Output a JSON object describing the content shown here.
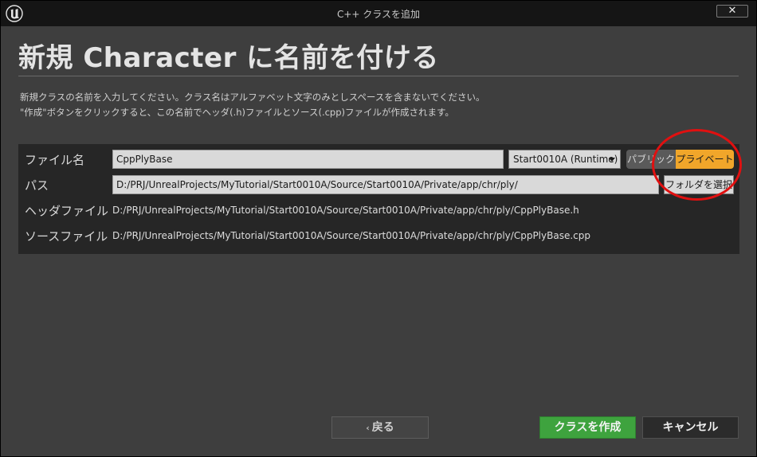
{
  "window": {
    "title": "C++ クラスを追加",
    "close_glyph": "✕"
  },
  "header": {
    "title": "新規 Character に名前を付ける",
    "description_line1": "新規クラスの名前を入力してください。クラス名はアルファベット文字のみとしスペースを含まないでください。",
    "description_line2": "\"作成\"ボタンをクリックすると、この名前でヘッダ(.h)ファイルとソース(.cpp)ファイルが作成されます。"
  },
  "form": {
    "name_label": "ファイル名",
    "name_value": "CppPlyBase",
    "module_value": "Start0010A (Runtime)",
    "visibility_public": "パブリック",
    "visibility_private": "プライベート",
    "selected_visibility": "private",
    "path_label": "パス",
    "path_value": "D:/PRJ/UnrealProjects/MyTutorial/Start0010A/Source/Start0010A/Private/app/chr/ply/",
    "browse_label": "フォルダを選択",
    "header_label": "ヘッダファイル",
    "header_value": "D:/PRJ/UnrealProjects/MyTutorial/Start0010A/Source/Start0010A/Private/app/chr/ply/CppPlyBase.h",
    "source_label": "ソースファイル",
    "source_value": "D:/PRJ/UnrealProjects/MyTutorial/Start0010A/Source/Start0010A/Private/app/chr/ply/CppPlyBase.cpp"
  },
  "footer": {
    "back_label": "戻る",
    "create_label": "クラスを作成",
    "cancel_label": "キャンセル"
  },
  "colors": {
    "accent_orange": "#f1a62a",
    "create_green": "#3ea33e",
    "annotation_red": "#e01010"
  }
}
